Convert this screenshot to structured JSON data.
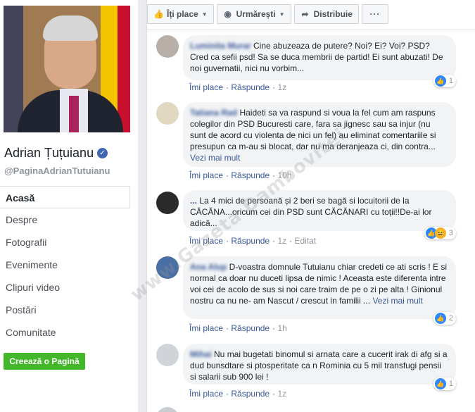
{
  "page": {
    "name": "Adrian Țuțuianu",
    "handle": "@PaginaAdrianTutuianu"
  },
  "nav": {
    "items": [
      {
        "label": "Acasă",
        "active": true
      },
      {
        "label": "Despre"
      },
      {
        "label": "Fotografii"
      },
      {
        "label": "Evenimente"
      },
      {
        "label": "Clipuri video"
      },
      {
        "label": "Postări"
      },
      {
        "label": "Comunitate"
      }
    ],
    "create_page": "Creează o Pagină"
  },
  "actions": {
    "like": "Îți place",
    "follow": "Urmărești",
    "share": "Distribuie",
    "more": "···"
  },
  "comments": [
    {
      "author": "Luminita Murar",
      "text": "Cine abuzeaza de putere? Noi? Ei? Voi? PSD? Cred ca sefii psd! Sa se duca membrii de partid! Ei sunt abuzati! De noi guvernatii, nici nu vorbim...",
      "like": "Îmi place",
      "reply": "Răspunde",
      "time": "1z",
      "reactions": 1
    },
    {
      "author": "Tatiana Rad",
      "text": "Haideti sa va raspund si voua la fel cum am raspuns colegilor din PSD Bucuresti care, fara sa jignesc sau sa injur (nu sunt de acord cu violenta de nici un fel) au eliminat comentariile si presupun ca m-au si blocat, dar nu ma deranjeaza ci, din contra...",
      "see_more": "Vezi mai mult",
      "like": "Îmi place",
      "reply": "Răspunde",
      "time": "10h"
    },
    {
      "author": "...",
      "text": "La 4 mici de persoană și 2 beri se bagă si locuitorii de la CĂCĂNA...oricum cei din PSD sunt CĂCĂNARI cu toții!!De-ai lor adică...",
      "like": "Îmi place",
      "reply": "Răspunde",
      "time": "1z",
      "edited": "Editat",
      "reactions": 3
    },
    {
      "author": "Ana Alup",
      "text": "D-voastra domnule Tutuianu chiar credeti ce ati scris ! E si normal ca doar nu duceti lipsa de nimic ! Aceasta este diferenta intre voi cei de acolo de sus si noi care traim de pe o zi pe alta ! Ginionul nostru ca nu ne- am Nascut / crescut in familii ...",
      "see_more": "Vezi mai mult",
      "like": "Îmi place",
      "reply": "Răspunde",
      "time": "1h",
      "reactions": 2
    },
    {
      "author": "Mihai",
      "text": "Nu mai bugetati binomul si arnata care a cucerit irak di afg si a dud bunsdtare si ptosperitate ca n Rominia cu 5 mil transfugi pensii si salarii sub 900 lei !",
      "like": "Îmi place",
      "reply": "Răspunde",
      "time": "1z",
      "reactions": 1
    }
  ],
  "watermark": "www.Gazeta Dambovitei"
}
